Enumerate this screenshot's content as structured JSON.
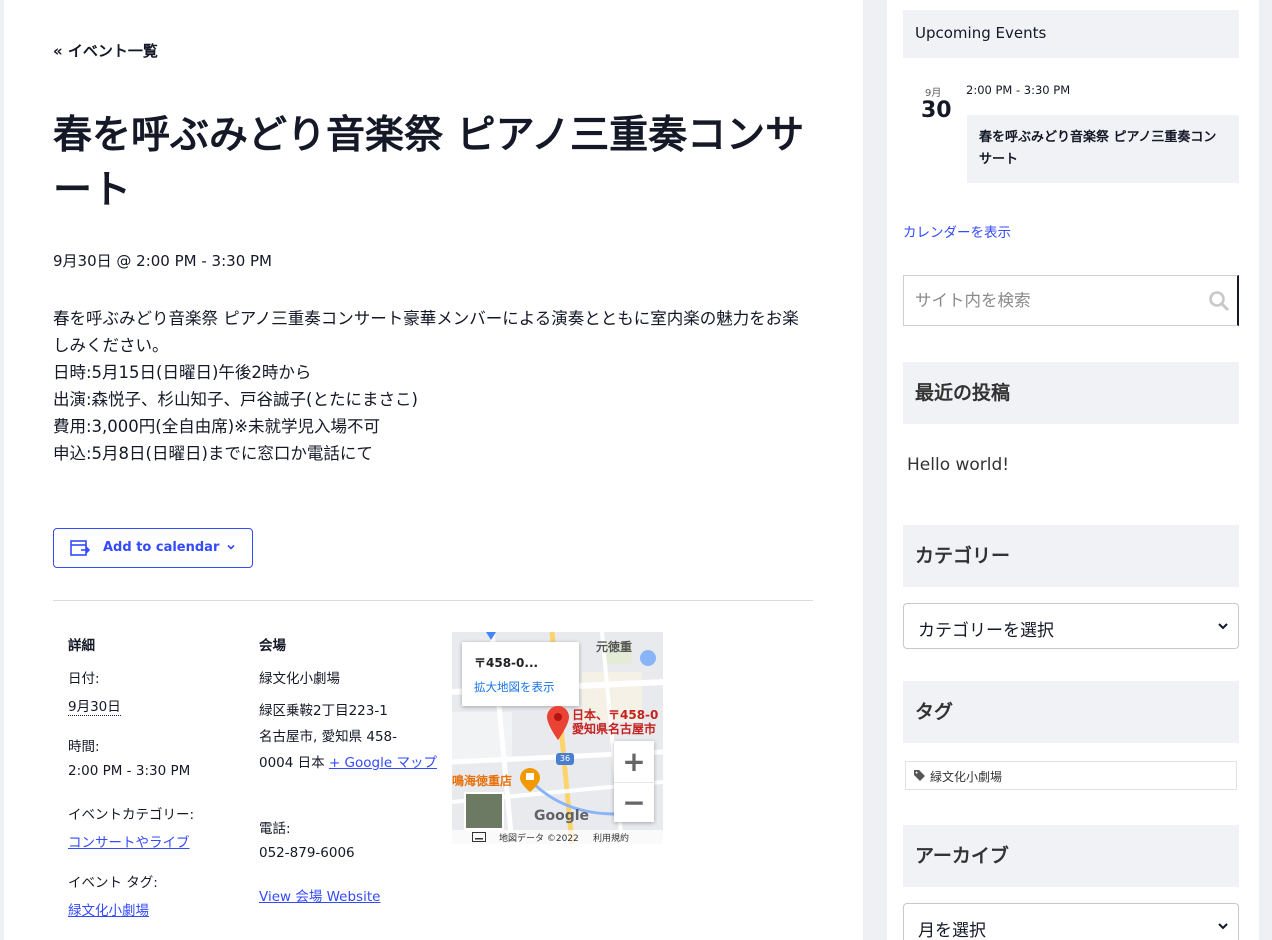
{
  "event": {
    "back_link": "« イベント一覧",
    "title": "春を呼ぶみどり音楽祭 ピアノ三重奏コンサート",
    "datetime": "9月30日 @ 2:00 PM - 3:30 PM",
    "description": [
      "春を呼ぶみどり音楽祭 ピアノ三重奏コンサート豪華メンバーによる演奏とともに室内楽の魅力をお楽しみください。",
      "日時:5月15日(日曜日)午後2時から",
      "出演:森悦子、杉山知子、戸谷誠子(とたにまさこ)",
      "費用:3,000円(全自由席)※未就学児入場不可",
      "申込:5月8日(日曜日)までに窓口か電話にて"
    ],
    "add_to_calendar": "Add to calendar"
  },
  "details": {
    "heading": "詳細",
    "date_label": "日付:",
    "date_value": "9月30日",
    "time_label": "時間:",
    "time_value": "2:00 PM - 3:30 PM",
    "category_label": "イベントカテゴリー:",
    "category_value": "コンサートやライブ",
    "tag_label": "イベント タグ:",
    "tag_value": "緑文化小劇場"
  },
  "venue": {
    "heading": "会場",
    "name": "緑文化小劇場",
    "address_line1": "緑区乗鞍2丁目223-1",
    "address_line2": "名古屋市, 愛知県 458-",
    "address_line3_prefix": "0004 日本",
    "google_map_link": "+ Google マップ",
    "phone_label": "電話:",
    "phone_value": "052-879-6006",
    "website_link": "View 会場 Website"
  },
  "map": {
    "info_zip": "〒458-0...",
    "info_enlarge": "拡大地図を表示",
    "place_top": "元徳重",
    "pin_label_line1": "日本、〒458-0",
    "pin_label_line2": "愛知県名古屋市",
    "poi": "鳴海徳重店",
    "route_number": "36",
    "logo": "Google",
    "footer_data": "地図データ ©2022",
    "footer_terms": "利用規約",
    "zoom_in": "+",
    "zoom_out": "−"
  },
  "sidebar": {
    "upcoming_title": "Upcoming Events",
    "upcoming_month": "9月",
    "upcoming_day": "30",
    "upcoming_time": "2:00 PM - 3:30 PM",
    "upcoming_event": "春を呼ぶみどり音楽祭 ピアノ三重奏コンサート",
    "view_calendar": "カレンダーを表示",
    "search_placeholder": "サイト内を検索",
    "recent_posts_title": "最近の投稿",
    "recent_post_1": "Hello world!",
    "categories_title": "カテゴリー",
    "categories_select": "カテゴリーを選択",
    "tags_title": "タグ",
    "tag_1": "緑文化小劇場",
    "archive_title": "アーカイブ",
    "archive_select": "月を選択"
  },
  "colors": {
    "accent": "#334aff",
    "text": "#141827",
    "panel": "#f0f2f5",
    "map_pin": "#ea4335"
  }
}
